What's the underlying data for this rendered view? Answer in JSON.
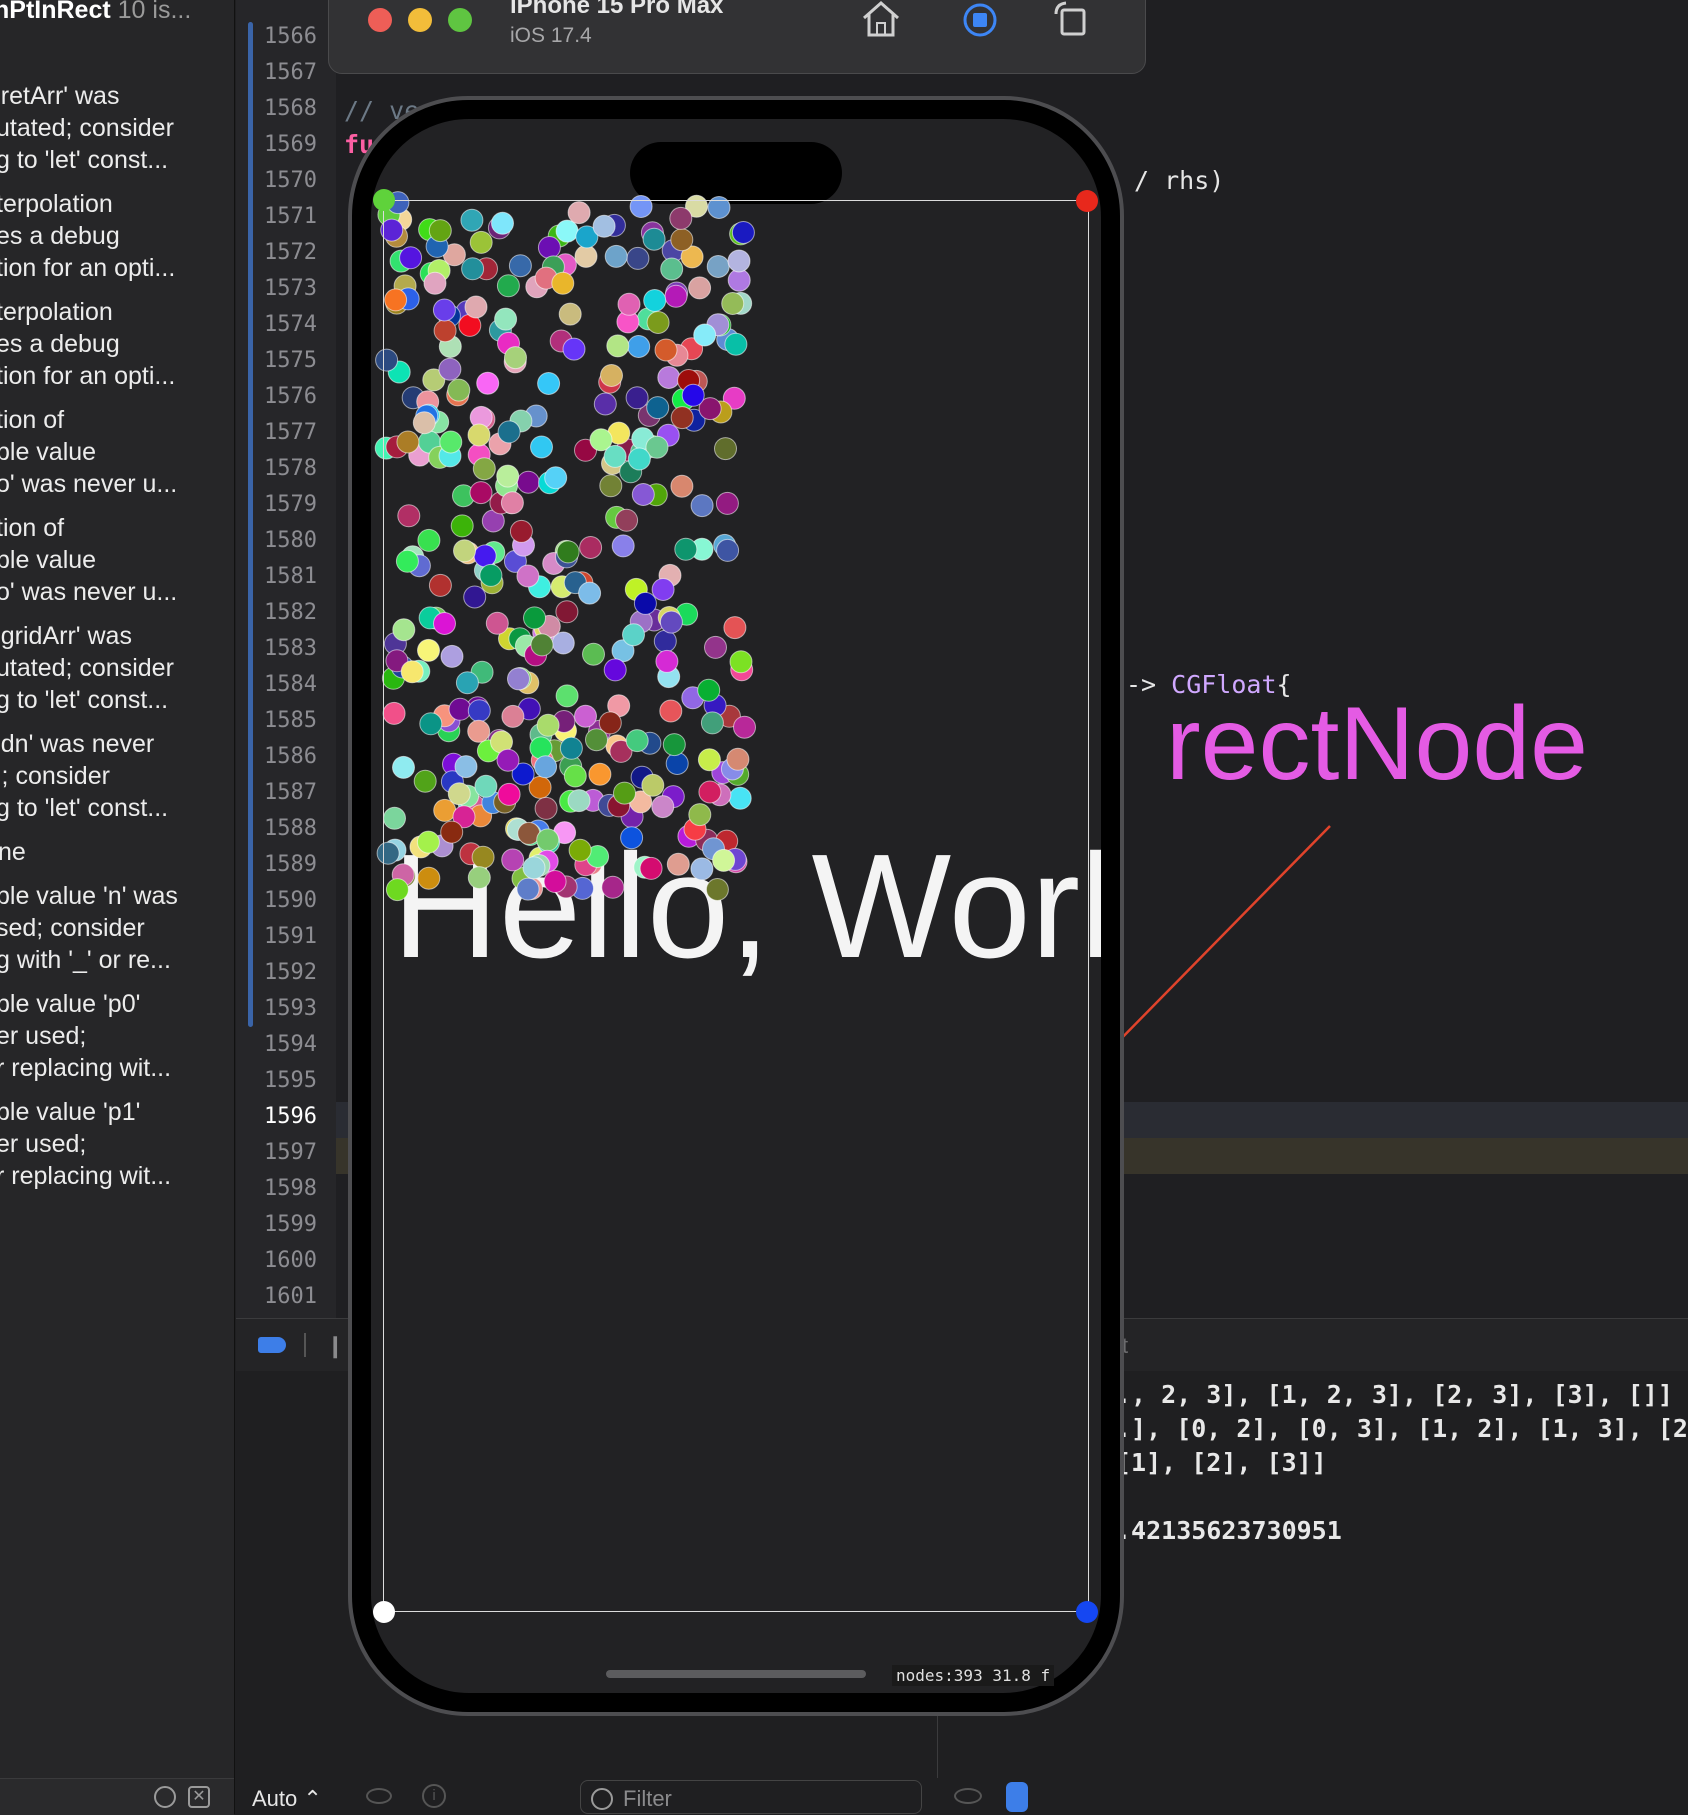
{
  "issues": {
    "header_bold": "nPtInRect",
    "header_count": "10 is...",
    "items": [
      [
        "'retArr' was",
        "utated; consider",
        "g to 'let' const..."
      ],
      [
        "terpolation",
        "es a debug",
        "tion for an opti..."
      ],
      [
        "terpolation",
        "es a debug",
        "tion for an opti..."
      ],
      [
        "tion of",
        "ble value",
        "o' was never u..."
      ],
      [
        "tion of",
        "ble value",
        "o' was never u..."
      ],
      [
        "'gridArr' was",
        "utated; consider",
        "g to 'let' const..."
      ],
      [
        "'dn' was never",
        "l; consider",
        "g to 'let' const..."
      ],
      [
        "ne"
      ],
      [
        "ble value 'n' was",
        "sed; consider",
        "g with '_' or re..."
      ],
      [
        "ble value 'p0'",
        "er used;",
        "r replacing wit..."
      ],
      [
        "ble value 'p1'",
        "er used;",
        "r replacing wit..."
      ]
    ]
  },
  "editor": {
    "line_numbers": [
      "1566",
      "1567",
      "1568",
      "1569",
      "1570",
      "1571",
      "1572",
      "1573",
      "1574",
      "1575",
      "1576",
      "1577",
      "1578",
      "1579",
      "1580",
      "1581",
      "1582",
      "1583",
      "1584",
      "1585",
      "1586",
      "1587",
      "1588",
      "1589",
      "1590",
      "1591",
      "1592",
      "1593",
      "1594",
      "1595",
      "1596",
      "1597",
      "1598",
      "1599",
      "1600",
      "1601"
    ],
    "current_line": "1596",
    "warning_line": "1597",
    "code_comment": "// ve",
    "code_func": "fu",
    "code_rhs": "/ rhs)",
    "code_arrow": "-> ",
    "code_type": "CGFloat",
    "code_brace": "{"
  },
  "annotation": {
    "label": "rectNode",
    "color": "#e45be4",
    "arrow_color": "#e0432b"
  },
  "simulator": {
    "device_name": "iPhone 15 Pro Max",
    "os_version": "iOS 17.4",
    "home_icon": "home-icon",
    "record_icon": "record-icon",
    "rotate_icon": "rotate-icon",
    "scene_text": "Hello, World!",
    "stats": "nodes:393   31.8 f"
  },
  "console": {
    "lines": [
      "., 2, 3], [1, 2, 3], [2, 3], [3], []]",
      ".], [0, 2], [0, 3], [1, 2], [1, 3], [2,",
      " [1], [2], [3]]",
      "",
      ".42135623730951"
    ],
    "filter_placeholder": "Filter",
    "auto_label": "Auto ⌃",
    "debug_suffix": "t"
  },
  "corners": {
    "top_left": "#5fd23b",
    "top_right": "#e8281c",
    "bottom_left": "#ffffff",
    "bottom_right": "#1547f2"
  }
}
